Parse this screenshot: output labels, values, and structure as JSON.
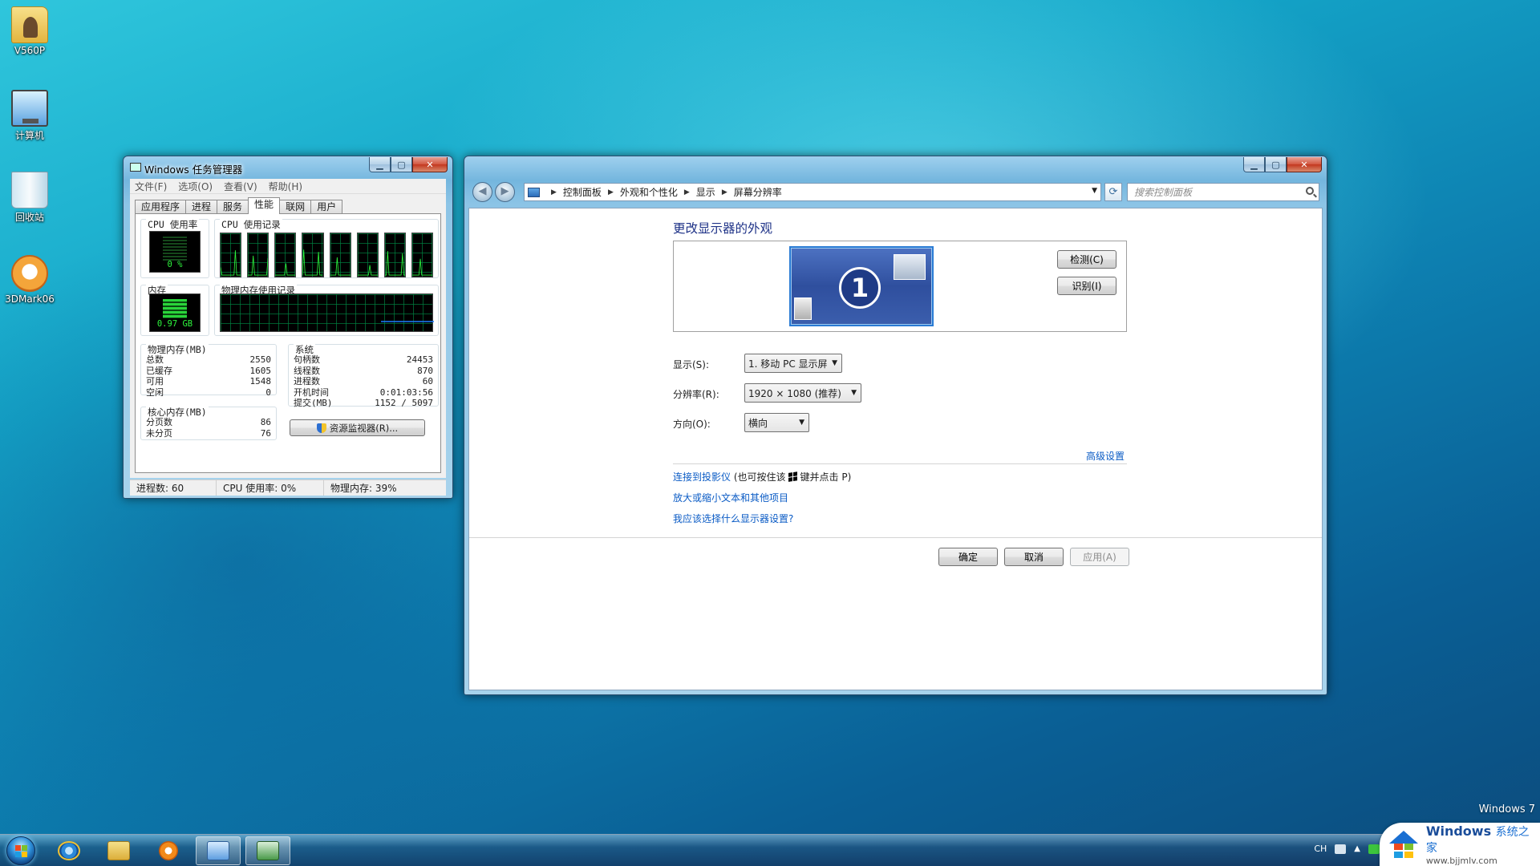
{
  "desktop": {
    "icons": [
      {
        "label": "V560P",
        "icon": "user-folder-icon"
      },
      {
        "label": "计算机",
        "icon": "computer-icon"
      },
      {
        "label": "回收站",
        "icon": "recycle-bin-icon"
      },
      {
        "label": "3DMark06",
        "icon": "3dmark-icon"
      }
    ],
    "os_label": "Windows 7"
  },
  "task_manager": {
    "title": "Windows 任务管理器",
    "menu": [
      "文件(F)",
      "选项(O)",
      "查看(V)",
      "帮助(H)"
    ],
    "tabs": [
      "应用程序",
      "进程",
      "服务",
      "性能",
      "联网",
      "用户"
    ],
    "active_tab": "性能",
    "cpu_usage_label": "CPU 使用率",
    "cpu_usage_value": "0 %",
    "cpu_history_label": "CPU 使用记录",
    "memory_label": "内存",
    "memory_value": "0.97 GB",
    "memory_history_label": "物理内存使用记录",
    "physical_memory": {
      "title": "物理内存(MB)",
      "rows": [
        {
          "label": "总数",
          "value": "2550"
        },
        {
          "label": "已缓存",
          "value": "1605"
        },
        {
          "label": "可用",
          "value": "1548"
        },
        {
          "label": "空闲",
          "value": "0"
        }
      ]
    },
    "kernel_memory": {
      "title": "核心内存(MB)",
      "rows": [
        {
          "label": "分页数",
          "value": "86"
        },
        {
          "label": "未分页",
          "value": "76"
        }
      ]
    },
    "system": {
      "title": "系统",
      "rows": [
        {
          "label": "句柄数",
          "value": "24453"
        },
        {
          "label": "线程数",
          "value": "870"
        },
        {
          "label": "进程数",
          "value": "60"
        },
        {
          "label": "开机时间",
          "value": "0:01:03:56"
        },
        {
          "label": "提交(MB)",
          "value": "1152 / 5097"
        }
      ]
    },
    "resource_monitor_button": "资源监视器(R)...",
    "status": {
      "processes": "进程数: 60",
      "cpu": "CPU 使用率: 0%",
      "memory": "物理内存: 39%"
    }
  },
  "control_panel": {
    "breadcrumb": [
      "控制面板",
      "外观和个性化",
      "显示",
      "屏幕分辨率"
    ],
    "search_placeholder": "搜索控制面板",
    "heading": "更改显示器的外观",
    "monitor_number": "1",
    "detect_button": "检测(C)",
    "identify_button": "识别(I)",
    "display_label": "显示(S):",
    "display_value": "1. 移动 PC 显示屏",
    "resolution_label": "分辨率(R):",
    "resolution_value": "1920 × 1080 (推荐)",
    "orientation_label": "方向(O):",
    "orientation_value": "横向",
    "advanced_link": "高级设置",
    "projector_link": "连接到投影仪",
    "projector_hint_prefix": "(也可按住该",
    "projector_hint_suffix": "键并点击 P)",
    "text_size_link": "放大或缩小文本和其他项目",
    "which_settings_link": "我应该选择什么显示器设置?",
    "ok_button": "确定",
    "cancel_button": "取消",
    "apply_button": "应用(A)"
  },
  "tray": {
    "ime": "CH"
  },
  "badge": {
    "title": "Windows",
    "title_suffix": "系统之家",
    "url": "www.bjjmlv.com"
  }
}
